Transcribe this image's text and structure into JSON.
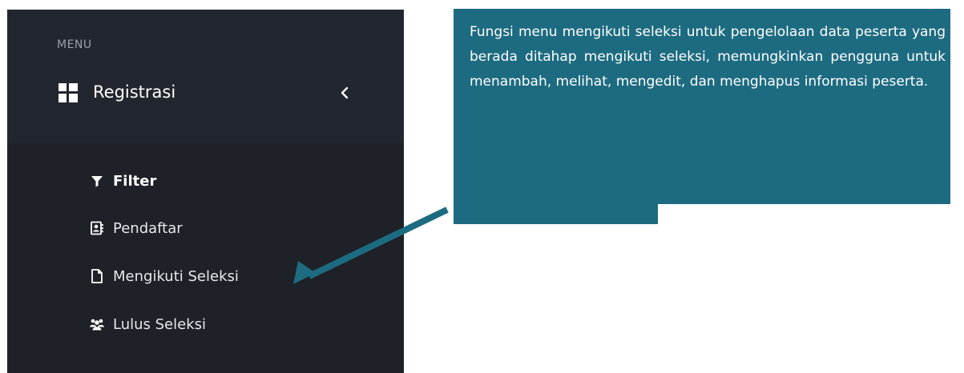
{
  "sidebar": {
    "menu_header": "MENU",
    "registrasi": {
      "label": "Registrasi",
      "icon": "grid-icon",
      "chevron": "chevron-left-icon"
    },
    "items": [
      {
        "label": "Filter",
        "icon": "filter-icon"
      },
      {
        "label": "Pendaftar",
        "icon": "contact-card-icon"
      },
      {
        "label": "Mengikuti Seleksi",
        "icon": "document-icon"
      },
      {
        "label": "Lulus Seleksi",
        "icon": "users-icon"
      }
    ]
  },
  "callout": {
    "text": "Fungsi menu mengikuti seleksi untuk pengelolaan data peserta yang berada ditahap mengikuti seleksi, memungkinkan pengguna untuk menambah, melihat, mengedit, dan menghapus informasi peserta."
  },
  "colors": {
    "sidebar_bg": "#22262e",
    "submenu_bg": "#1e2128",
    "callout_bg": "#1d6b80",
    "arrow": "#1d6b80"
  }
}
